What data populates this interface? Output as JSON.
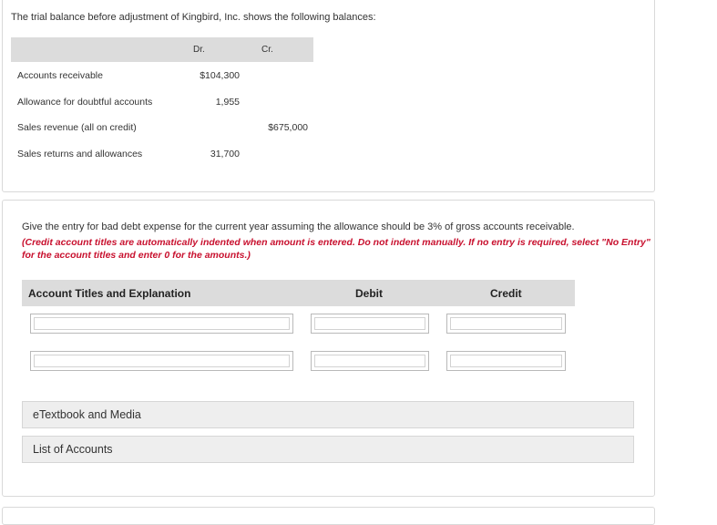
{
  "intro": "The trial balance before adjustment of Kingbird, Inc. shows the following balances:",
  "trial_balance": {
    "headers": {
      "dr": "Dr.",
      "cr": "Cr."
    },
    "rows": [
      {
        "account": "Accounts receivable",
        "dr": "$104,300",
        "cr": ""
      },
      {
        "account": "Allowance for doubtful accounts",
        "dr": "1,955",
        "cr": ""
      },
      {
        "account": "Sales revenue (all on credit)",
        "dr": "",
        "cr": "$675,000"
      },
      {
        "account": "Sales returns and allowances",
        "dr": "31,700",
        "cr": ""
      }
    ]
  },
  "question": "Give the entry for bad debt expense for the current year assuming the allowance should be 3% of gross accounts receivable.",
  "instruction_line1": "(Credit account titles are automatically indented when amount is entered. Do not indent manually. If no entry is required, select \"No Entry\"",
  "instruction_line2": "for the account titles and enter 0 for the amounts.)",
  "journal": {
    "headers": {
      "account": "Account Titles and Explanation",
      "debit": "Debit",
      "credit": "Credit"
    },
    "rows": [
      {
        "account": "",
        "debit": "",
        "credit": ""
      },
      {
        "account": "",
        "debit": "",
        "credit": ""
      }
    ]
  },
  "links": {
    "etextbook": "eTextbook and Media",
    "list_of_accounts": "List of Accounts"
  }
}
